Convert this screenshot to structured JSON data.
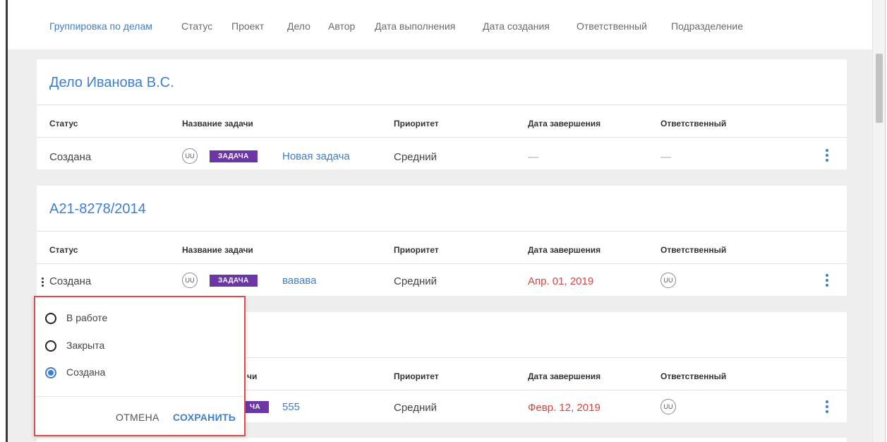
{
  "filters": {
    "items": [
      "Группировка по делам",
      "Статус",
      "Проект",
      "Дело",
      "Автор",
      "Дата выполнения",
      "Дата создания",
      "Ответственный",
      "Подразделение"
    ],
    "active_index": 0
  },
  "columns": {
    "status": "Статус",
    "task_name": "Название задачи",
    "priority": "Приоритет",
    "due_date": "Дата завершения",
    "assignee": "Ответственный"
  },
  "groups": [
    {
      "title": "Дело Иванова В.С.",
      "row": {
        "status": "Создана",
        "avatar": "UU",
        "tag": "ЗАДАЧА",
        "task": "Новая задача",
        "priority": "Средний",
        "due": "—",
        "assignee": "—"
      }
    },
    {
      "title": "А21-8278/2014",
      "row": {
        "status": "Создана",
        "avatar": "UU",
        "tag": "ЗАДАЧА",
        "task": "вавава",
        "priority": "Средний",
        "due": "Апр. 01, 2019",
        "assignee_avatar": "UU"
      }
    },
    {
      "title": "",
      "row": {
        "name_header_visible": "чи",
        "tag_visible": "ЧА",
        "task": "555",
        "priority": "Средний",
        "due": "Февр. 12, 2019",
        "assignee_avatar": "UU"
      }
    }
  ],
  "status_popup": {
    "options": [
      "В работе",
      "Закрыта",
      "Создана"
    ],
    "selected_index": 2,
    "cancel_label": "ОТМЕНА",
    "save_label": "СОХРАНИТЬ"
  },
  "colors": {
    "accent": "#3d7fd0",
    "tag": "#6b37a5",
    "overdue": "#e0413c",
    "popup_border": "#e14a4a"
  }
}
